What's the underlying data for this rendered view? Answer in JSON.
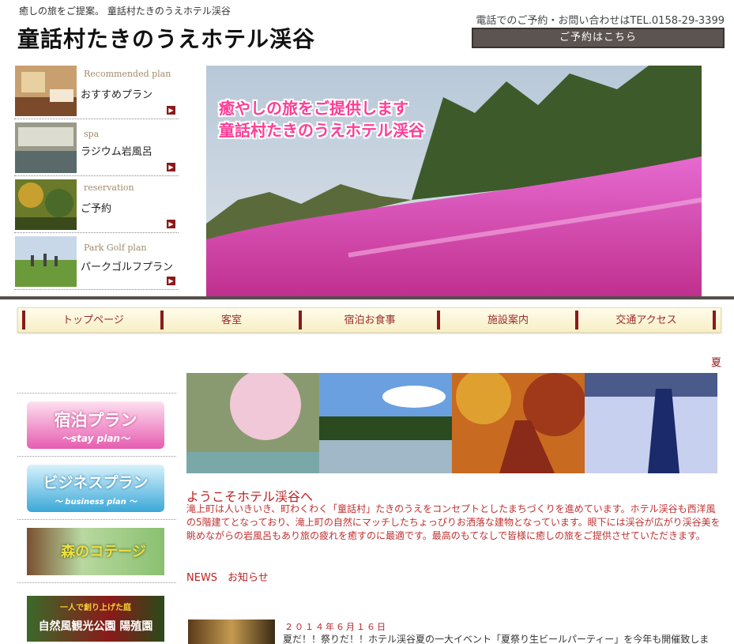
{
  "header": {
    "tagline": "癒しの旅をご提案。 童話村たきのうえホテル渓谷",
    "title": "童話村たきのうえホテル渓谷",
    "phone": "電話でのご予約・お問い合わせはTEL.0158-29-3399",
    "reserve_button": "ご予約はこちら"
  },
  "plans": [
    {
      "en": "Recommended plan",
      "jp": "おすすめプラン"
    },
    {
      "en": "spa",
      "jp": "ラジウム岩風呂"
    },
    {
      "en": "reservation",
      "jp": "ご予約"
    },
    {
      "en": "Park Golf plan",
      "jp": "パークゴルフプラン"
    }
  ],
  "hero": {
    "caption_line1": "癒やしの旅をご提供します",
    "caption_line2": "童話村たきのうえホテル渓谷"
  },
  "nav": [
    "トップページ",
    "客室",
    "宿泊お食事",
    "施設案内",
    "交通アクセス"
  ],
  "ticker": "夏",
  "banners": [
    {
      "title": "宿泊プラン",
      "sub": "～stay plan～"
    },
    {
      "title": "ビジネスプラン",
      "sub": "～ business plan ～"
    },
    {
      "title": "森のコテージ"
    },
    {
      "title": "自然風観光公園 陽殖園",
      "sub": "一人で創り上げた庭"
    }
  ],
  "welcome": {
    "title": "ようこそホテル渓谷へ",
    "body": "滝上町は人いきいき、町わくわく「童話村」たきのうえをコンセプトとしたまちづくりを進めています。ホテル渓谷も西洋風の5階建てとなっており、滝上町の自然にマッチしたちょっぴりお洒落な建物となっています。眼下には渓谷が広がり渓谷美を眺めながらの岩風呂もあり旅の疲れを癒すのに最適です。最高のもてなしで皆様に癒しの旅をご提供させていただきます。"
  },
  "news": {
    "heading": "NEWS　お知らせ",
    "date": "２０１４年６月１６日",
    "text": "夏だ！！祭りだ！！ホテル渓谷夏の一大イベント「夏祭り生ビールパーティー」を今年も開催致しま"
  },
  "colors": {
    "accent": "#8b1a1a",
    "text_red": "#b22222",
    "moss_pink": "#e040a8"
  }
}
